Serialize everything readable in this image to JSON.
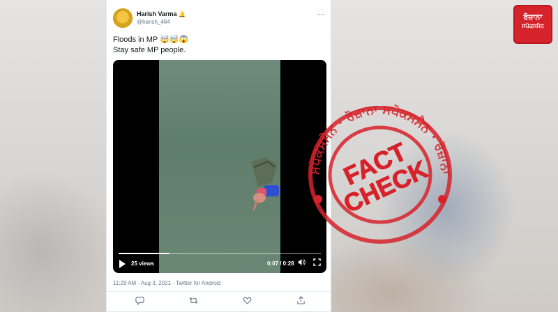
{
  "tweet": {
    "author_name": "Harish Varma",
    "author_badge": "🔔",
    "handle": "@harish_484",
    "more_icon": "⋯",
    "line1": "Floods in MP 🤯🤯😱",
    "line2": "Stay safe MP people.",
    "meta": "11:29 AM · Aug 3, 2021 · Twitter for Android"
  },
  "video": {
    "views": "25 views",
    "time": "0:07 / 0:28",
    "progress": 0.25
  },
  "actions": {
    "reply_icon": "💬",
    "retweet_icon": "🔁",
    "like_icon": "♡",
    "share_icon": "⇪"
  },
  "stamp": {
    "line1": "FACT",
    "line2": "CHECK",
    "ring_text": "ਸਪੋਕਸਮੈਨ · ਰੋਜ਼ਾਨਾ ਸਪੋਕਸਮੈਨ · ਰੋਜ਼ਾਨਾ",
    "color": "#d6232b"
  },
  "logo": {
    "line1": "ਰੋਜ਼ਾਨਾ",
    "line2": "ਸਪੋਕਸਮੈਨ",
    "color": "#d6232b"
  }
}
